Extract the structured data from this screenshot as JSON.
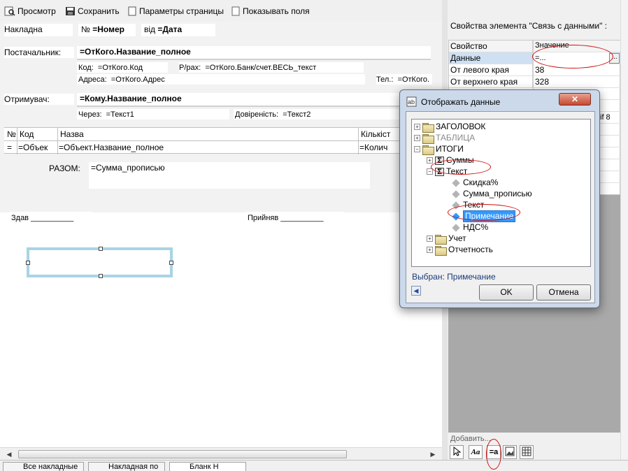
{
  "toolbar": {
    "preview": "Просмотр",
    "save": "Сохранить",
    "page_params": "Параметры страницы",
    "show_fields": "Показывать поля"
  },
  "form": {
    "invoice_label": "Накладна",
    "number_label": "№",
    "number_field": "=Номер",
    "date_label": "від",
    "date_field": "=Дата",
    "supplier_label": "Постачальник:",
    "supplier_field": "=ОтКого.Название_полное",
    "code_label": "Код:",
    "code_field": "=ОтКого.Код",
    "account_label": "Р/рах:",
    "account_field": "=ОтКого.Банк/счет.ВЕСЬ_текст",
    "address_label": "Адреса:",
    "address_field": "=ОтКого.Адрес",
    "phone_label": "Тел.:",
    "phone_field": "=ОтКого.",
    "recipient_label": "Отримувач:",
    "recipient_field": "=Кому.Название_полное",
    "through_label": "Через:",
    "through_field": "=Текст1",
    "proxy_label": "Довіреність:",
    "proxy_field": "=Текст2",
    "table_headers": [
      "№",
      "Код",
      "Назва",
      "Кількіст"
    ],
    "table_row": [
      "=",
      "=Объек",
      "=Объект.Название_полное",
      "=Колич"
    ],
    "total_label": "РАЗОМ:",
    "total_field": "=Сумма_прописью",
    "handed_label": "Здав",
    "handed_line": "__________",
    "accepted_label": "Прийняв",
    "accepted_line": "__________"
  },
  "properties": {
    "title": "Свойства элемента \"Связь с данными\" :",
    "col_property": "Свойство",
    "col_value": "Значение",
    "rows": [
      {
        "name": "Данные",
        "value": "=..."
      },
      {
        "name": "От левого края",
        "value": "38"
      },
      {
        "name": "От верхнего края",
        "value": "328"
      }
    ],
    "partial_value": "if 8",
    "add_label": "Добавить...",
    "ellipsis": "..."
  },
  "dialog": {
    "title": "Отображать данные",
    "close": "✕",
    "tree": [
      {
        "label": "ЗАГОЛОВОК",
        "kind": "folder",
        "expander": "+",
        "muted": false
      },
      {
        "label": "ТАБЛИЦА",
        "kind": "folder",
        "expander": "+",
        "muted": true
      },
      {
        "label": "ИТОГИ",
        "kind": "folder",
        "expander": "−",
        "muted": false
      },
      {
        "label": "Суммы",
        "kind": "sigma",
        "expander": "+",
        "muted": false
      },
      {
        "label": "Текст",
        "kind": "sigma",
        "expander": "−",
        "muted": false
      },
      {
        "label": "Скидка%",
        "kind": "item",
        "muted": false
      },
      {
        "label": "Сумма_прописью",
        "kind": "item",
        "muted": false
      },
      {
        "label": "Текст",
        "kind": "item",
        "muted": false
      },
      {
        "label": "Примечание",
        "kind": "item",
        "selected": true
      },
      {
        "label": "НДС%",
        "kind": "item",
        "muted": false
      },
      {
        "label": "Учет",
        "kind": "folder",
        "expander": "+",
        "muted": false
      },
      {
        "label": "Отчетность",
        "kind": "folder",
        "expander": "+",
        "muted": false
      }
    ],
    "selected_prefix": "Выбран:",
    "selected_value": "Примечание",
    "ok": "OK",
    "cancel": "Отмена"
  },
  "status_tabs": [
    "Все накладные",
    "Накладная по",
    "Бланк Н"
  ],
  "icons": [
    "preview-icon",
    "save-icon",
    "page-icon",
    "checkbox-icon",
    "pointer-icon",
    "font-icon",
    "data-link-icon",
    "image-icon",
    "table-icon"
  ],
  "colors": {
    "selection": "#3399ff",
    "highlight_row": "#cfe0f3",
    "annotation": "#d01010",
    "frame": "#a8d4e4"
  }
}
